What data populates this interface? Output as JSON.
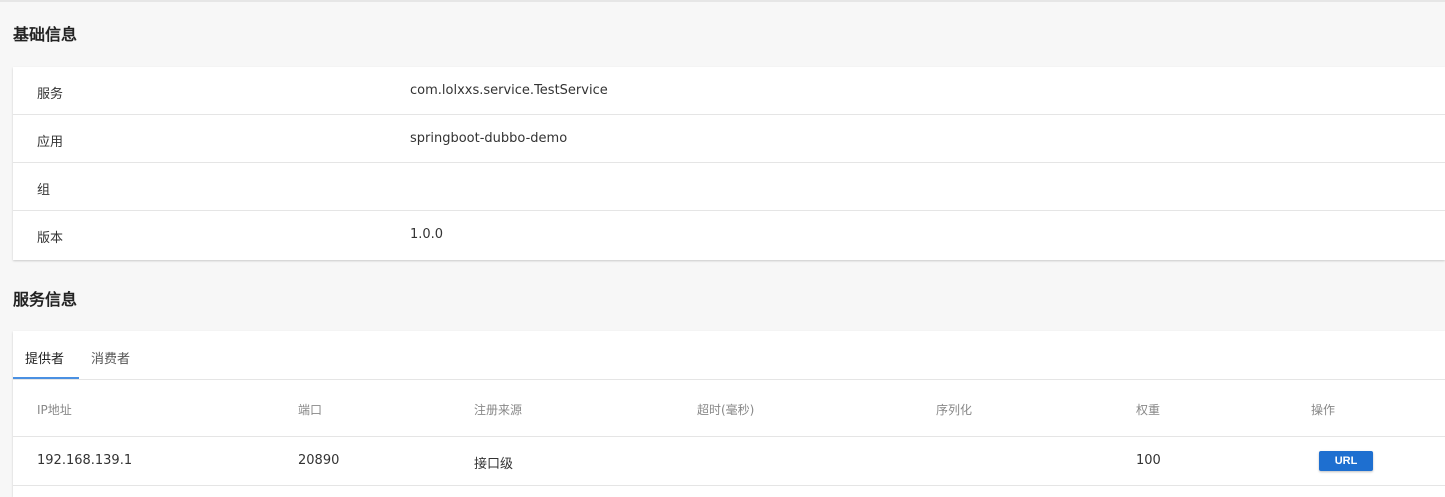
{
  "sections": {
    "basic_title": "基础信息",
    "service_title": "服务信息"
  },
  "basic_info": {
    "rows": [
      {
        "label": "服务",
        "value": "com.lolxxs.service.TestService"
      },
      {
        "label": "应用",
        "value": "springboot-dubbo-demo"
      },
      {
        "label": "组",
        "value": ""
      },
      {
        "label": "版本",
        "value": "1.0.0"
      }
    ]
  },
  "service_info": {
    "tabs": [
      {
        "label": "提供者",
        "active": true
      },
      {
        "label": "消费者",
        "active": false
      }
    ],
    "columns": [
      "IP地址",
      "端口",
      "注册来源",
      "超时(毫秒)",
      "序列化",
      "权重",
      "操作"
    ],
    "rows": [
      {
        "ip": "192.168.139.1",
        "port": "20890",
        "source": "接口级",
        "timeout": "",
        "serialization": "",
        "weight": "100",
        "action_label": "URL"
      }
    ]
  },
  "colors": {
    "accent": "#4a90e2",
    "button": "#1e6fd0"
  }
}
